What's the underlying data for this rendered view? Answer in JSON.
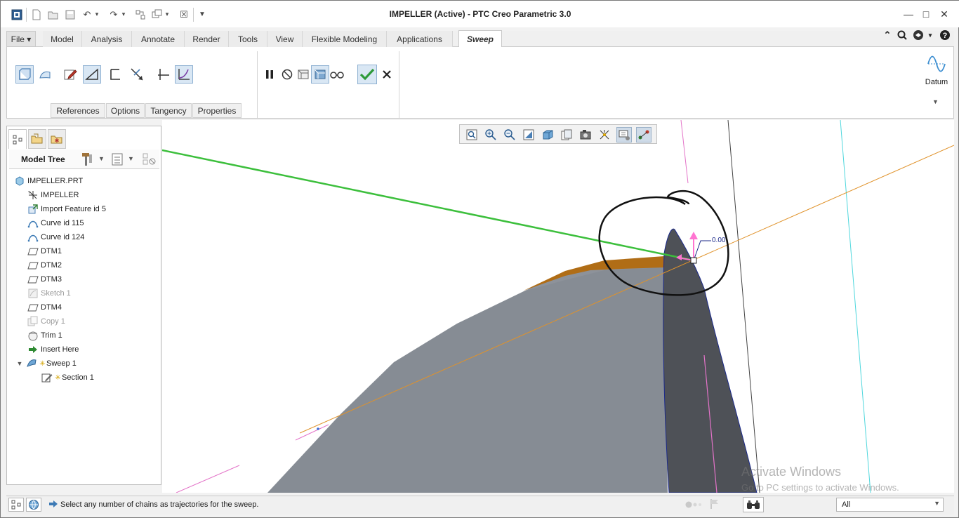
{
  "window": {
    "title": "IMPELLER (Active) - PTC Creo Parametric 3.0"
  },
  "menu_tabs": [
    {
      "label": "File ▾"
    },
    {
      "label": "Model"
    },
    {
      "label": "Analysis"
    },
    {
      "label": "Annotate"
    },
    {
      "label": "Render"
    },
    {
      "label": "Tools"
    },
    {
      "label": "View"
    },
    {
      "label": "Flexible Modeling"
    },
    {
      "label": "Applications"
    },
    {
      "label": "Sweep"
    }
  ],
  "ribbon": {
    "subtabs": [
      "References",
      "Options",
      "Tangency",
      "Properties"
    ],
    "datum_label": "Datum"
  },
  "model_tree": {
    "header": "Model Tree",
    "items": [
      {
        "label": "IMPELLER.PRT",
        "icon": "part-icon",
        "dim": false
      },
      {
        "label": "IMPELLER",
        "icon": "coordinate-system-icon",
        "dim": false
      },
      {
        "label": "Import Feature id 5",
        "icon": "import-feature-icon",
        "dim": false
      },
      {
        "label": "Curve id 115",
        "icon": "curve-icon",
        "dim": false
      },
      {
        "label": "Curve id 124",
        "icon": "curve-icon",
        "dim": false
      },
      {
        "label": "DTM1",
        "icon": "datum-plane-icon",
        "dim": false
      },
      {
        "label": "DTM2",
        "icon": "datum-plane-icon",
        "dim": false
      },
      {
        "label": "DTM3",
        "icon": "datum-plane-icon",
        "dim": false
      },
      {
        "label": "Sketch 1",
        "icon": "sketch-icon",
        "dim": true
      },
      {
        "label": "DTM4",
        "icon": "datum-plane-icon",
        "dim": false
      },
      {
        "label": "Copy 1",
        "icon": "copy-icon",
        "dim": true
      },
      {
        "label": "Trim 1",
        "icon": "trim-icon",
        "dim": false
      },
      {
        "label": "Insert Here",
        "icon": "insert-arrow-icon",
        "dim": false
      },
      {
        "label": "Sweep 1",
        "icon": "sweep-icon",
        "dim": false
      },
      {
        "label": "Section 1",
        "icon": "section-icon",
        "dim": false
      }
    ]
  },
  "viewport": {
    "dimension_label": "0.00"
  },
  "status": {
    "message": "Select any number of chains as trajectories for the sweep.",
    "filter_value": "All"
  },
  "watermark": {
    "line1": "Activate Windows",
    "line2": "Go to PC settings to activate Windows."
  },
  "colors": {
    "accent_blue": "#4a7fb5",
    "confirm_green": "#2e9a3a",
    "surface_grey": "#868c94",
    "blade_dark": "#4e5157",
    "trajectory_green": "#3cbf3c",
    "axis_orange": "#e0922a"
  }
}
